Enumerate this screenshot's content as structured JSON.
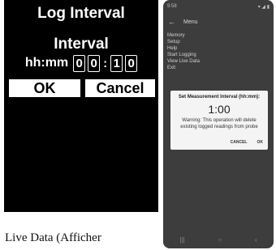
{
  "left_device": {
    "title": "Log Interval",
    "subtitle": "Interval",
    "time_label": "hh:mm",
    "digits": [
      "0",
      "0",
      "1",
      "0"
    ],
    "separator": ":",
    "buttons": {
      "ok": "OK",
      "cancel": "Cancel"
    }
  },
  "caption": "Live Data (Afficher",
  "phone": {
    "status": {
      "time": "9:58",
      "icons": "▾ ◢ ▮"
    },
    "app_bar": {
      "back_icon": "arrow-left-icon",
      "title": "Menu"
    },
    "menu_items": [
      "Memory",
      "Setup",
      "Help",
      "Start Logging",
      "View Live Data",
      "Exit"
    ],
    "dialog": {
      "title": "Set Measurement Interval (hh:mm):",
      "value": "1:00",
      "warning": "Warning: This operation will delete existing logged readings from probe",
      "cancel_label": "CANCEL",
      "ok_label": "OK"
    },
    "nav": {
      "icons": [
        "menu-icon",
        "home-icon",
        "back-icon"
      ]
    }
  }
}
